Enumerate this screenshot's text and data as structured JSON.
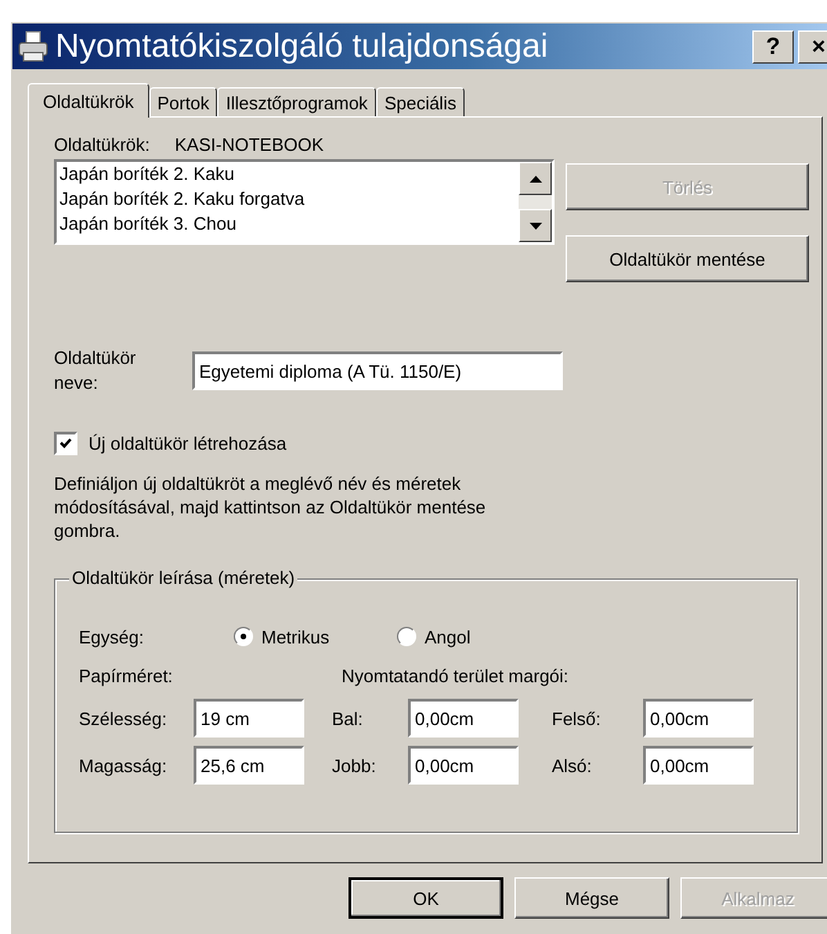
{
  "window": {
    "title": "Nyomtatókiszolgáló tulajdonságai",
    "help_button": "?",
    "close_button": "×"
  },
  "tabs": [
    {
      "label": "Oldaltükrök",
      "selected": true
    },
    {
      "label": "Portok",
      "selected": false
    },
    {
      "label": "Illesztőprogramok",
      "selected": false
    },
    {
      "label": "Speciális",
      "selected": false
    }
  ],
  "forms": {
    "server_label": "Oldaltükrök:",
    "server_name": "KASI-NOTEBOOK",
    "list": [
      "Japán boríték 2. Kaku",
      "Japán boríték 2. Kaku forgatva",
      "Japán boríték 3. Chou"
    ],
    "delete_button": {
      "label": "Törlés",
      "disabled": true
    },
    "save_button": {
      "label": "Oldaltükör mentése",
      "disabled": false
    },
    "name_label": "Oldaltükör neve:",
    "name_value": "Egyetemi diploma (A Tü. 1150/E)",
    "create_checkbox": {
      "label": "Új oldaltükör létrehozása",
      "checked": true
    },
    "description": "Definiáljon új oldaltükröt a meglévő név és méretek módosításával, majd kattintson az Oldaltükör mentése gombra.",
    "group": {
      "title": "Oldaltükör leírása (méretek)",
      "unit_label": "Egység:",
      "units": [
        {
          "label": "Metrikus",
          "selected": true
        },
        {
          "label": "Angol",
          "selected": false
        }
      ],
      "paper_label": "Papírméret:",
      "margins_label": "Nyomtatandó terület margói:",
      "rows": [
        [
          {
            "label": "Szélesség:",
            "value": "19 cm"
          },
          {
            "label": "Bal:",
            "value": "0,00cm"
          },
          {
            "label": "Felső:",
            "value": "0,00cm"
          }
        ],
        [
          {
            "label": "Magasság:",
            "value": "25,6 cm"
          },
          {
            "label": "Jobb:",
            "value": "0,00cm"
          },
          {
            "label": "Alsó:",
            "value": "0,00cm"
          }
        ]
      ]
    }
  },
  "buttons": [
    {
      "label": "OK",
      "disabled": false,
      "default": true
    },
    {
      "label": "Mégse",
      "disabled": false,
      "default": false
    },
    {
      "label": "Alkalmaz",
      "disabled": true,
      "default": false
    }
  ]
}
